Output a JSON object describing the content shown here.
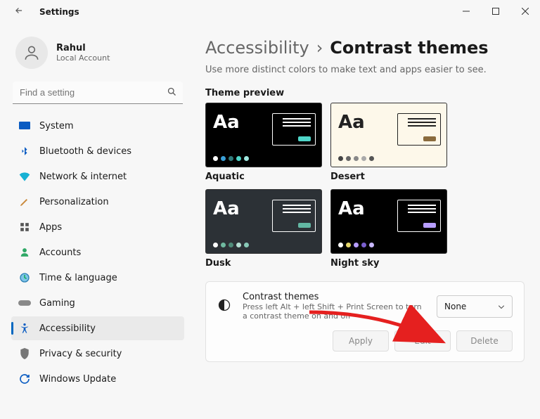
{
  "window": {
    "title": "Settings"
  },
  "user": {
    "name": "Rahul",
    "sub": "Local Account"
  },
  "search": {
    "placeholder": "Find a setting"
  },
  "nav": {
    "items": [
      {
        "label": "System"
      },
      {
        "label": "Bluetooth & devices"
      },
      {
        "label": "Network & internet"
      },
      {
        "label": "Personalization"
      },
      {
        "label": "Apps"
      },
      {
        "label": "Accounts"
      },
      {
        "label": "Time & language"
      },
      {
        "label": "Gaming"
      },
      {
        "label": "Accessibility"
      },
      {
        "label": "Privacy & security"
      },
      {
        "label": "Windows Update"
      }
    ]
  },
  "breadcrumb": {
    "parent": "Accessibility",
    "sep": "›",
    "current": "Contrast themes"
  },
  "subtitle": "Use more distinct colors to make text and apps easier to see.",
  "section": {
    "preview": "Theme preview"
  },
  "tiles": [
    {
      "label": "Aquatic"
    },
    {
      "label": "Desert"
    },
    {
      "label": "Dusk"
    },
    {
      "label": "Night sky"
    }
  ],
  "card": {
    "title": "Contrast themes",
    "desc": "Press left Alt + left Shift + Print Screen to turn a contrast theme on and off",
    "dropdown": "None",
    "buttons": {
      "apply": "Apply",
      "edit": "Edit",
      "delete": "Delete"
    }
  }
}
